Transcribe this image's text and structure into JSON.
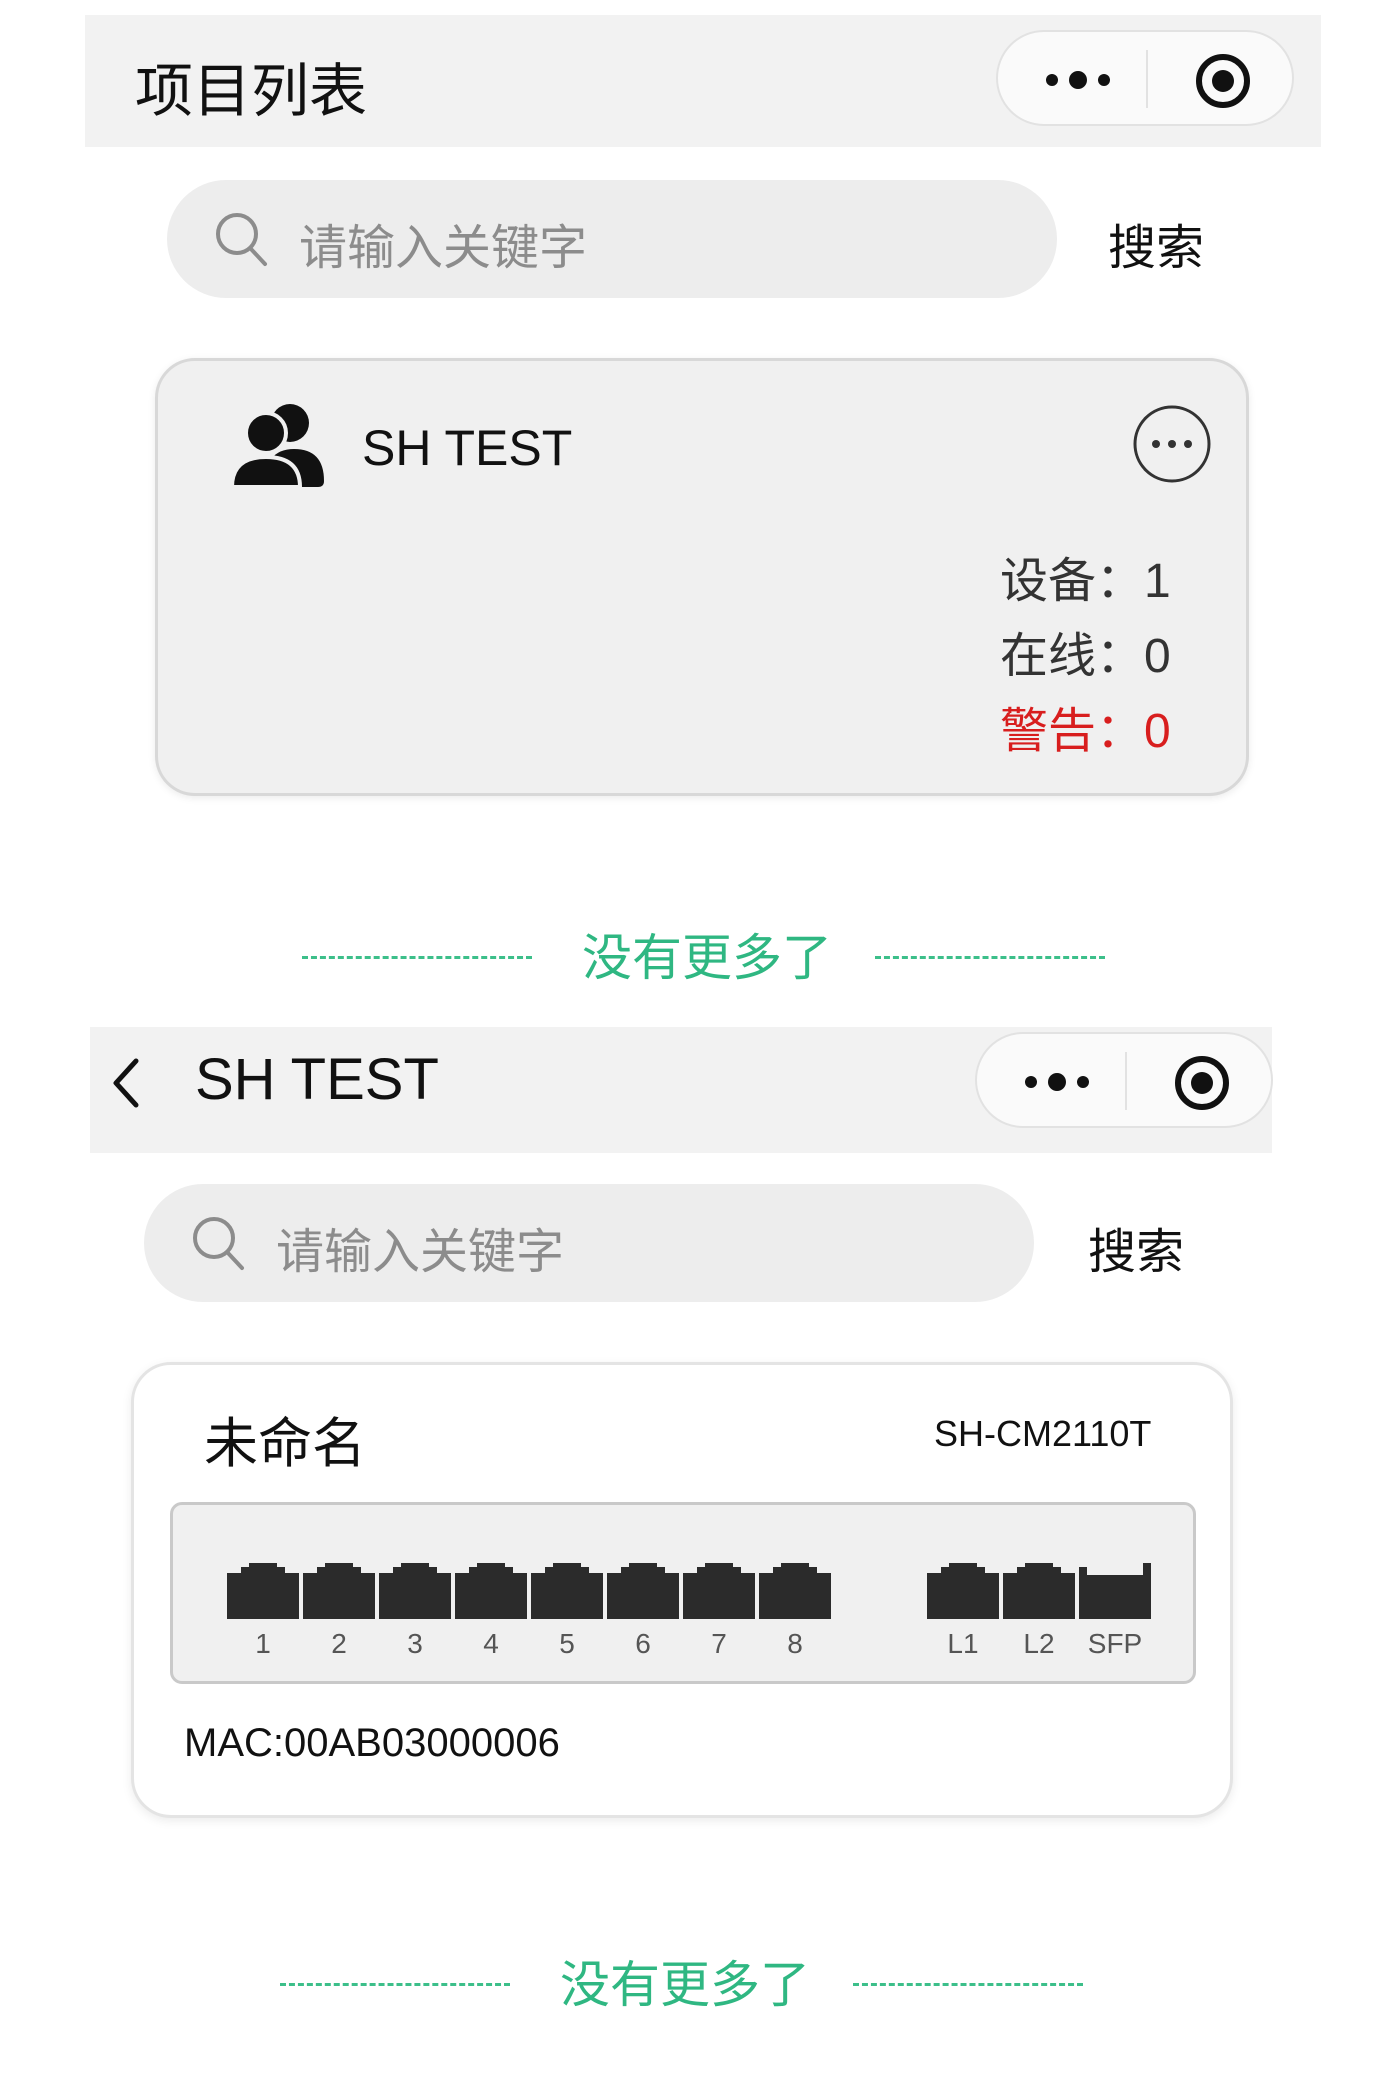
{
  "screen1": {
    "nav": {
      "title": "项目列表"
    },
    "search": {
      "placeholder": "请输入关键字",
      "button": "搜索"
    },
    "project_card": {
      "name": "SH TEST",
      "stats": [
        {
          "label": "设备：",
          "value": "1"
        },
        {
          "label": "在线：",
          "value": "0"
        },
        {
          "label": "警告：",
          "value": "0"
        }
      ]
    },
    "footer": "没有更多了"
  },
  "screen2": {
    "nav": {
      "back": "‹",
      "title": "SH TEST"
    },
    "search": {
      "placeholder": "请输入关键字",
      "button": "搜索"
    },
    "device_card": {
      "name": "未命名",
      "model": "SH-CM2110T",
      "ports": [
        "1",
        "2",
        "3",
        "4",
        "5",
        "6",
        "7",
        "8"
      ],
      "uplinks": [
        "L1",
        "L2",
        "SFP"
      ],
      "mac": "MAC:00AB03000006"
    },
    "footer": "没有更多了"
  },
  "colors": {
    "accent_green": "#2fb782",
    "warning_red": "#d81e1e"
  }
}
